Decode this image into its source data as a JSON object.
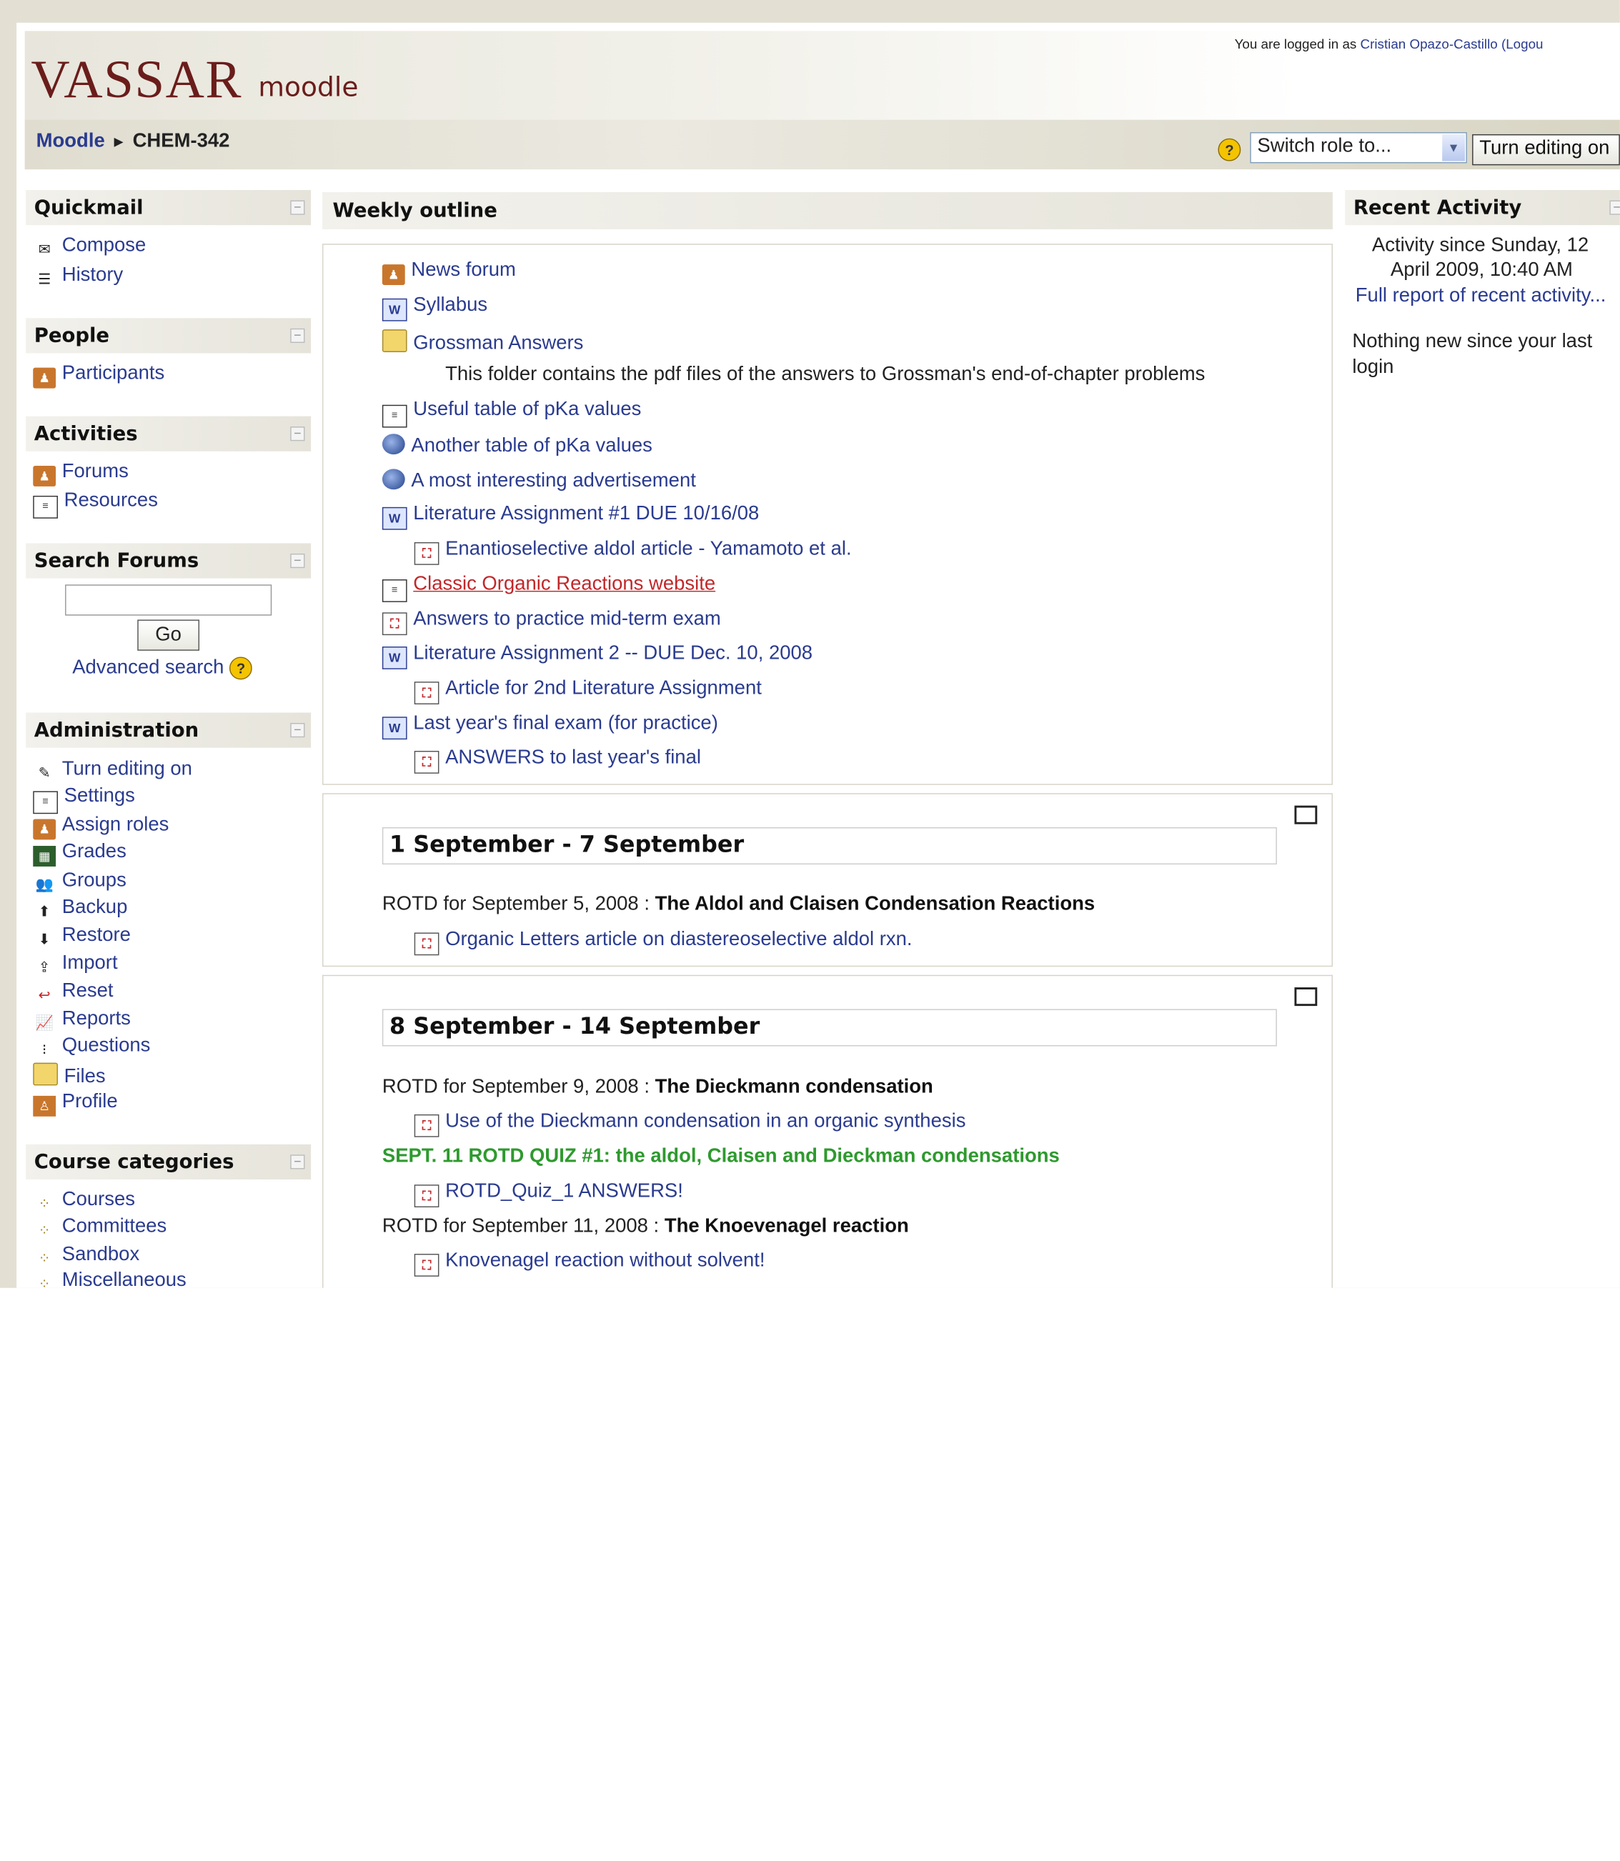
{
  "header": {
    "logo_main": "VASSAR",
    "logo_sub": "moodle",
    "login_prefix": "You are logged in as",
    "user_link": "Cristian Opazo-Castillo",
    "logout_link": "(Logou",
    "breadcrumb_home": "Moodle",
    "breadcrumb_sep": "►",
    "breadcrumb_current": "CHEM-342",
    "help_glyph": "?",
    "switch_role": "Switch role to...",
    "edit_button": "Turn editing on"
  },
  "sidebar": {
    "quickmail": {
      "title": "Quickmail",
      "items": [
        "Compose",
        "History"
      ]
    },
    "people": {
      "title": "People",
      "items": [
        "Participants"
      ]
    },
    "activities": {
      "title": "Activities",
      "items": [
        "Forums",
        "Resources"
      ]
    },
    "search": {
      "title": "Search Forums",
      "go": "Go",
      "advanced": "Advanced search"
    },
    "admin": {
      "title": "Administration",
      "items": [
        "Turn editing on",
        "Settings",
        "Assign roles",
        "Grades",
        "Groups",
        "Backup",
        "Restore",
        "Import",
        "Reset",
        "Reports",
        "Questions",
        "Files",
        "Profile"
      ]
    },
    "categories": {
      "title": "Course categories",
      "items": [
        "Courses",
        "Committees",
        "Sandbox",
        "Miscellaneous"
      ]
    }
  },
  "main": {
    "title": "Weekly outline",
    "section0": [
      "News forum",
      "Syllabus",
      "Grossman Answers",
      "This folder contains the pdf files of the answers to Grossman's end-of-chapter problems",
      "Useful table of pKa values",
      "Another table of pKa values",
      "A most interesting advertisement",
      "Literature Assignment #1 DUE 10/16/08",
      "Enantioselective aldol article - Yamamoto et al.",
      "Classic Organic Reactions website",
      "Answers to practice mid-term exam",
      "Literature Assignment 2 -- DUE Dec. 10, 2008",
      "Article for 2nd Literature Assignment",
      "Last year's final exam (for practice)",
      "ANSWERS to last year's final"
    ],
    "week1": {
      "title": "1 September - 7 September",
      "rotd_prefix": "ROTD for September 5, 2008 :",
      "rotd_bold": "The Aldol and Claisen Condensation Reactions",
      "link": "Organic Letters article on diastereoselective aldol rxn."
    },
    "week2": {
      "title": "8 September - 14 September",
      "rotd1_prefix": "ROTD for September 9, 2008 :",
      "rotd1_bold": "The Dieckmann condensation",
      "link1": "Use of the Dieckmann condensation in an organic synthesis",
      "quiz": "SEPT. 11 ROTD QUIZ #1: the aldol, Claisen and Dieckman condensations",
      "link2": "ROTD_Quiz_1 ANSWERS!",
      "rotd2_prefix": "ROTD for September 11, 2008 :",
      "rotd2_bold": "The Knoevenagel reaction",
      "link3": "Knovenagel reaction without solvent!"
    }
  },
  "right": {
    "title": "Recent Activity",
    "since_line1": "Activity since Sunday, 12",
    "since_line2": "April 2009, 10:40 AM",
    "full_report": "Full report of recent activity...",
    "nothing_new_1": "Nothing new since your last",
    "nothing_new_2": "login"
  },
  "colors": {
    "link": "#2a3b8f",
    "brand": "#6a1d1b",
    "highlight": "#c0282b",
    "green": "#2e9a2e"
  }
}
